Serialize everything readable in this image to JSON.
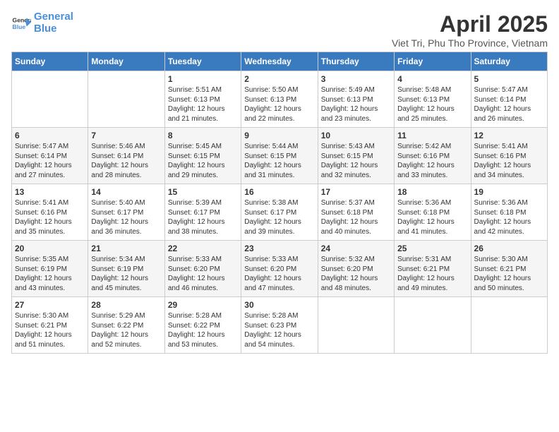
{
  "logo": {
    "line1": "General",
    "line2": "Blue"
  },
  "title": "April 2025",
  "subtitle": "Viet Tri, Phu Tho Province, Vietnam",
  "days_of_week": [
    "Sunday",
    "Monday",
    "Tuesday",
    "Wednesday",
    "Thursday",
    "Friday",
    "Saturday"
  ],
  "weeks": [
    [
      {
        "day": "",
        "info": ""
      },
      {
        "day": "",
        "info": ""
      },
      {
        "day": "1",
        "info": "Sunrise: 5:51 AM\nSunset: 6:13 PM\nDaylight: 12 hours and 21 minutes."
      },
      {
        "day": "2",
        "info": "Sunrise: 5:50 AM\nSunset: 6:13 PM\nDaylight: 12 hours and 22 minutes."
      },
      {
        "day": "3",
        "info": "Sunrise: 5:49 AM\nSunset: 6:13 PM\nDaylight: 12 hours and 23 minutes."
      },
      {
        "day": "4",
        "info": "Sunrise: 5:48 AM\nSunset: 6:13 PM\nDaylight: 12 hours and 25 minutes."
      },
      {
        "day": "5",
        "info": "Sunrise: 5:47 AM\nSunset: 6:14 PM\nDaylight: 12 hours and 26 minutes."
      }
    ],
    [
      {
        "day": "6",
        "info": "Sunrise: 5:47 AM\nSunset: 6:14 PM\nDaylight: 12 hours and 27 minutes."
      },
      {
        "day": "7",
        "info": "Sunrise: 5:46 AM\nSunset: 6:14 PM\nDaylight: 12 hours and 28 minutes."
      },
      {
        "day": "8",
        "info": "Sunrise: 5:45 AM\nSunset: 6:15 PM\nDaylight: 12 hours and 29 minutes."
      },
      {
        "day": "9",
        "info": "Sunrise: 5:44 AM\nSunset: 6:15 PM\nDaylight: 12 hours and 31 minutes."
      },
      {
        "day": "10",
        "info": "Sunrise: 5:43 AM\nSunset: 6:15 PM\nDaylight: 12 hours and 32 minutes."
      },
      {
        "day": "11",
        "info": "Sunrise: 5:42 AM\nSunset: 6:16 PM\nDaylight: 12 hours and 33 minutes."
      },
      {
        "day": "12",
        "info": "Sunrise: 5:41 AM\nSunset: 6:16 PM\nDaylight: 12 hours and 34 minutes."
      }
    ],
    [
      {
        "day": "13",
        "info": "Sunrise: 5:41 AM\nSunset: 6:16 PM\nDaylight: 12 hours and 35 minutes."
      },
      {
        "day": "14",
        "info": "Sunrise: 5:40 AM\nSunset: 6:17 PM\nDaylight: 12 hours and 36 minutes."
      },
      {
        "day": "15",
        "info": "Sunrise: 5:39 AM\nSunset: 6:17 PM\nDaylight: 12 hours and 38 minutes."
      },
      {
        "day": "16",
        "info": "Sunrise: 5:38 AM\nSunset: 6:17 PM\nDaylight: 12 hours and 39 minutes."
      },
      {
        "day": "17",
        "info": "Sunrise: 5:37 AM\nSunset: 6:18 PM\nDaylight: 12 hours and 40 minutes."
      },
      {
        "day": "18",
        "info": "Sunrise: 5:36 AM\nSunset: 6:18 PM\nDaylight: 12 hours and 41 minutes."
      },
      {
        "day": "19",
        "info": "Sunrise: 5:36 AM\nSunset: 6:18 PM\nDaylight: 12 hours and 42 minutes."
      }
    ],
    [
      {
        "day": "20",
        "info": "Sunrise: 5:35 AM\nSunset: 6:19 PM\nDaylight: 12 hours and 43 minutes."
      },
      {
        "day": "21",
        "info": "Sunrise: 5:34 AM\nSunset: 6:19 PM\nDaylight: 12 hours and 45 minutes."
      },
      {
        "day": "22",
        "info": "Sunrise: 5:33 AM\nSunset: 6:20 PM\nDaylight: 12 hours and 46 minutes."
      },
      {
        "day": "23",
        "info": "Sunrise: 5:33 AM\nSunset: 6:20 PM\nDaylight: 12 hours and 47 minutes."
      },
      {
        "day": "24",
        "info": "Sunrise: 5:32 AM\nSunset: 6:20 PM\nDaylight: 12 hours and 48 minutes."
      },
      {
        "day": "25",
        "info": "Sunrise: 5:31 AM\nSunset: 6:21 PM\nDaylight: 12 hours and 49 minutes."
      },
      {
        "day": "26",
        "info": "Sunrise: 5:30 AM\nSunset: 6:21 PM\nDaylight: 12 hours and 50 minutes."
      }
    ],
    [
      {
        "day": "27",
        "info": "Sunrise: 5:30 AM\nSunset: 6:21 PM\nDaylight: 12 hours and 51 minutes."
      },
      {
        "day": "28",
        "info": "Sunrise: 5:29 AM\nSunset: 6:22 PM\nDaylight: 12 hours and 52 minutes."
      },
      {
        "day": "29",
        "info": "Sunrise: 5:28 AM\nSunset: 6:22 PM\nDaylight: 12 hours and 53 minutes."
      },
      {
        "day": "30",
        "info": "Sunrise: 5:28 AM\nSunset: 6:23 PM\nDaylight: 12 hours and 54 minutes."
      },
      {
        "day": "",
        "info": ""
      },
      {
        "day": "",
        "info": ""
      },
      {
        "day": "",
        "info": ""
      }
    ]
  ]
}
